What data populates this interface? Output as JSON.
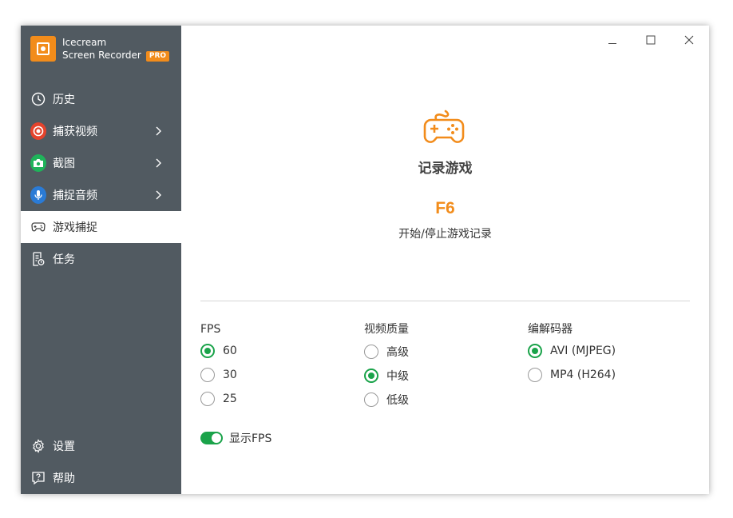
{
  "app": {
    "name_line1": "Icecream",
    "name_line2": "Screen Recorder",
    "badge": "PRO",
    "accent_color": "#f28c1b",
    "sidebar_bg": "#515a61",
    "selected_color": "#1aa34a"
  },
  "sidebar": {
    "items": [
      {
        "label": "历史",
        "icon": "clock-icon"
      },
      {
        "label": "捕获视频",
        "icon": "record-icon"
      },
      {
        "label": "截图",
        "icon": "camera-icon"
      },
      {
        "label": "捕捉音频",
        "icon": "microphone-icon"
      },
      {
        "label": "游戏捕捉",
        "icon": "gamepad-icon"
      },
      {
        "label": "任务",
        "icon": "tasks-icon"
      }
    ],
    "bottom": [
      {
        "label": "设置",
        "icon": "gear-icon"
      },
      {
        "label": "帮助",
        "icon": "help-icon"
      }
    ]
  },
  "main": {
    "title": "记录游戏",
    "hotkey": "F6",
    "hotkey_desc": "开始/停止游戏记录",
    "fps": {
      "title": "FPS",
      "options": [
        "60",
        "30",
        "25"
      ],
      "selected": "60"
    },
    "quality": {
      "title": "视频质量",
      "options": [
        "高级",
        "中级",
        "低级"
      ],
      "selected": "中级"
    },
    "codec": {
      "title": "编解码器",
      "options": [
        "AVI (MJPEG)",
        "MP4 (H264)"
      ],
      "selected": "AVI (MJPEG)"
    },
    "show_fps": {
      "label": "显示FPS",
      "enabled": true
    }
  }
}
